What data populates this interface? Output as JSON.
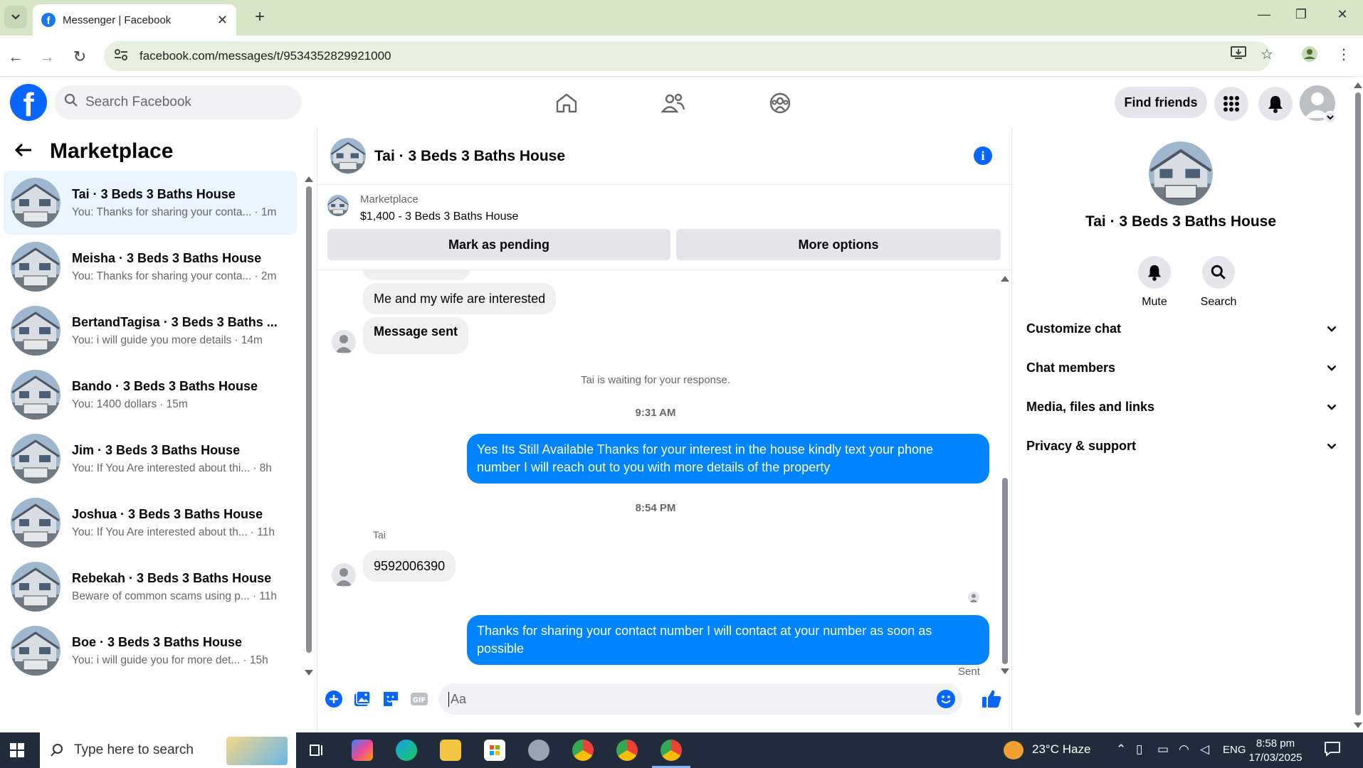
{
  "browser": {
    "tab_title": "Messenger | Facebook",
    "url": "facebook.com/messages/t/9534352829921000"
  },
  "fb": {
    "search_placeholder": "Search Facebook",
    "find_friends": "Find friends"
  },
  "marketplace": {
    "title": "Marketplace",
    "conversations": [
      {
        "name": "Tai · 3 Beds 3 Baths House",
        "preview": "You: Thanks for sharing your conta...",
        "time": "· 1m",
        "active": true
      },
      {
        "name": "Meisha · 3 Beds 3 Baths House",
        "preview": "You: Thanks for sharing your conta...",
        "time": "· 2m"
      },
      {
        "name": "BertandTagisa · 3 Beds 3 Baths ...",
        "preview": "You: i will guide you more details",
        "time": "· 14m"
      },
      {
        "name": "Bando · 3 Beds 3 Baths House",
        "preview": "You: 1400 dollars",
        "time": "· 15m"
      },
      {
        "name": "Jim · 3 Beds 3 Baths House",
        "preview": "You: If You Are interested about thi...",
        "time": "· 8h"
      },
      {
        "name": "Joshua · 3 Beds 3 Baths House",
        "preview": "You: If You Are interested about th...",
        "time": "· 11h"
      },
      {
        "name": "Rebekah · 3 Beds 3 Baths House",
        "preview": "Beware of common scams using p...",
        "time": "· 11h"
      },
      {
        "name": "Boe · 3 Beds 3 Baths House",
        "preview": "You: i will guide you for more det...",
        "time": "· 15h"
      }
    ]
  },
  "chat": {
    "title": "Tai · 3 Beds 3 Baths House",
    "listing_label": "Marketplace",
    "listing_item": "$1,400 - 3 Beds 3 Baths House",
    "mark_pending": "Mark as pending",
    "more_options": "More options",
    "msg_interested": "Me and my wife are interested",
    "msg_sent": "Message sent",
    "waiting": "Tai is waiting for your response.",
    "time1": "9:31 AM",
    "reply1_line1": "Yes Its Still Available Thanks for your interest in the house kindly text your phone",
    "reply1_line2": "number I will reach out to you with more details of the property",
    "time2": "8:54 PM",
    "sender": "Tai",
    "phone": "9592006390",
    "reply2_line1": "Thanks for sharing your contact number I will contact at your number as soon as",
    "reply2_line2": "possible",
    "status": "Sent",
    "composer_placeholder": "Aa",
    "accent": "#0084ff"
  },
  "details": {
    "name": "Tai · 3 Beds 3 Baths House",
    "mute": "Mute",
    "search": "Search",
    "sections": [
      "Customize chat",
      "Chat members",
      "Media, files and links",
      "Privacy & support"
    ]
  },
  "taskbar": {
    "search_placeholder": "Type here to search",
    "weather": "23°C  Haze",
    "lang": "ENG",
    "time": "8:58 pm",
    "date": "17/03/2025"
  }
}
